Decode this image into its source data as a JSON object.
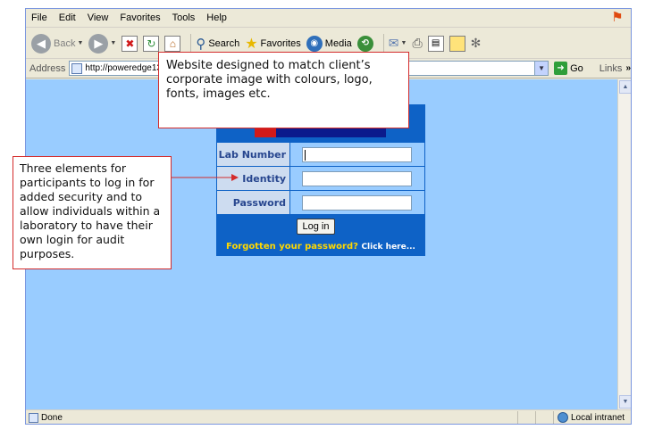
{
  "menu": {
    "file": "File",
    "edit": "Edit",
    "view": "View",
    "favorites": "Favorites",
    "tools": "Tools",
    "help": "Help"
  },
  "toolbar": {
    "back": "Back",
    "search": "Search",
    "favorites": "Favorites",
    "media": "Media"
  },
  "addressbar": {
    "label": "Address",
    "url": "http://poweredge1300/",
    "go": "Go",
    "links": "Links"
  },
  "login": {
    "fields": [
      {
        "label": "Lab Number",
        "value": ""
      },
      {
        "label": "Identity",
        "value": ""
      },
      {
        "label": "Password",
        "value": ""
      }
    ],
    "button": "Log in",
    "forgot_text": "Forgotten your password?",
    "click_here": "Click here..."
  },
  "status": {
    "text": "Done",
    "zone": "Local intranet"
  },
  "callouts": {
    "top": "Website designed to match client’s corporate image with colours, logo, fonts, images etc.",
    "left": "Three elements for participants to log in for added security and to allow individuals within a laboratory to have their own login for audit purposes."
  },
  "colors": {
    "page_background": "#99ccff",
    "panel_blue": "#0e62c6",
    "callout_border": "#d42b2b",
    "forgot_yellow": "#ffd800"
  }
}
